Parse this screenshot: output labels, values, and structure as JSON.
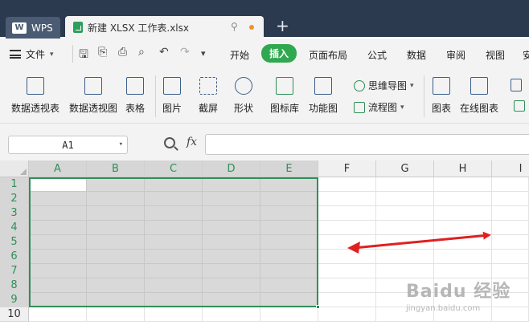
{
  "titlebar": {
    "wps_tab_label": "WPS",
    "doc_tab_label": "新建 XLSX 工作表.xlsx"
  },
  "menubar": {
    "file_label": "文件",
    "items": [
      "开始",
      "插入",
      "页面布局",
      "公式",
      "数据",
      "审阅",
      "视图",
      "安"
    ],
    "active": "插入"
  },
  "ribbon": {
    "pivot_table": "数据透视表",
    "pivot_chart": "数据透视图",
    "table": "表格",
    "picture": "图片",
    "screenshot": "截屏",
    "shape": "形状",
    "icon_library": "图标库",
    "function_chart": "功能图",
    "mind_map": "思维导图",
    "flowchart": "流程图",
    "chart": "图表",
    "online_chart": "在线图表"
  },
  "formula_bar": {
    "cell_ref": "A1",
    "fx_label": "fx",
    "formula_value": ""
  },
  "sheet": {
    "columns": [
      "A",
      "B",
      "C",
      "D",
      "E",
      "F",
      "G",
      "H",
      "I"
    ],
    "rows": [
      "1",
      "2",
      "3",
      "4",
      "5",
      "6",
      "7",
      "8",
      "9",
      "10"
    ],
    "selection": "A1:E9",
    "active_cell": "A1"
  },
  "watermark": {
    "main": "Baidu 经验",
    "sub": "jingyan.baidu.com"
  },
  "colors": {
    "accent": "#2fa84f",
    "selection_border": "#2f8f57",
    "annotation_arrow": "#e02020",
    "tabbar_bg": "#2b3a4e"
  }
}
